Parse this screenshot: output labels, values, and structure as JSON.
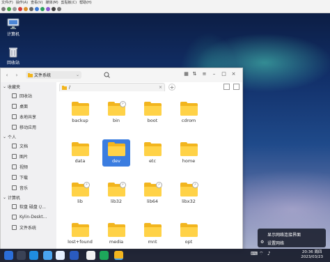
{
  "vm_menu": [
    "文件(F)",
    "操作(A)",
    "查看(V)",
    "媒体(M)",
    "剪贴板(C)",
    "帮助(H)"
  ],
  "desktop": {
    "icons": [
      {
        "label": "计算机"
      },
      {
        "label": "回收站"
      }
    ]
  },
  "file_manager": {
    "location_label": "文件系统",
    "tab_label": "/",
    "sidebar": {
      "sections": [
        {
          "label": "收藏夹",
          "items": [
            "回收站",
            "桌面",
            "本地共享",
            "移动应用"
          ]
        },
        {
          "label": "个人",
          "items": [
            "文档",
            "图片",
            "视频",
            "下载",
            "音乐"
          ]
        },
        {
          "label": "计算机",
          "items": [
            "软盘 磁盘 (/...",
            "Kylin-Deskt...",
            "文件系统"
          ]
        }
      ]
    },
    "files": [
      "backup",
      "bin",
      "boot",
      "cdrom",
      "data",
      "dev",
      "etc",
      "home",
      "lib",
      "lib32",
      "lib64",
      "libx32",
      "lost+found",
      "media",
      "mnt",
      "opt"
    ],
    "selected_file": "dev",
    "linked_files": [
      "bin",
      "lib",
      "lib32",
      "lib64",
      "libx32"
    ]
  },
  "network_popup": {
    "line1": "显示网络连接界面",
    "line2": "设置网络"
  },
  "taskbar": {
    "time": "20:36 周四",
    "date": "2023/03/23"
  },
  "colors": {
    "folder": "#f2b51e",
    "selection": "#3b7de0"
  }
}
